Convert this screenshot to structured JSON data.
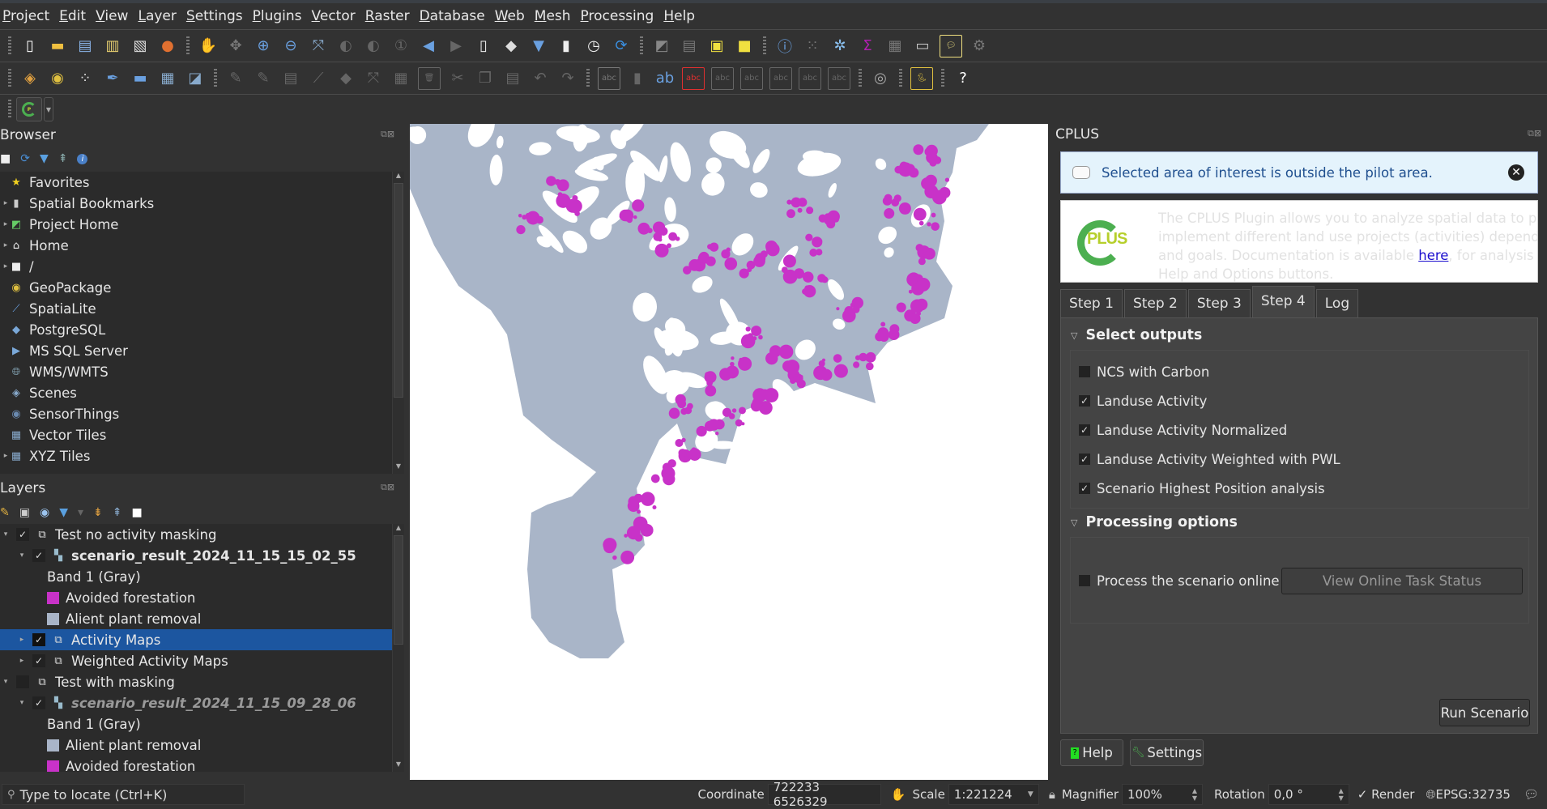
{
  "menubar": [
    "Project",
    "Edit",
    "View",
    "Layer",
    "Settings",
    "Plugins",
    "Vector",
    "Raster",
    "Database",
    "Web",
    "Mesh",
    "Processing",
    "Help"
  ],
  "toolbar1_icons": [
    "new-project-icon",
    "open-project-icon",
    "save-project-icon",
    "new-print-layout-icon",
    "layout-manager-icon",
    "style-manager-icon",
    "pan-icon",
    "pan-to-selection-icon",
    "zoom-in-icon",
    "zoom-out-icon",
    "zoom-full-icon",
    "zoom-to-selection-icon",
    "zoom-to-layer-icon",
    "zoom-native-icon",
    "zoom-last-icon",
    "zoom-next-icon",
    "new-map-view-icon",
    "new-3d-map-icon",
    "new-bookmark-icon",
    "show-bookmarks-icon",
    "temporal-controller-icon",
    "refresh-icon",
    "select-features-icon",
    "open-attribute-table-icon",
    "deselect-icon",
    "select-by-location-icon",
    "identify-icon",
    "statistics-icon",
    "processing-toolbox-icon",
    "field-calculator-icon",
    "attribute-table-icon",
    "measure-icon",
    "map-tips-icon",
    "run-model-icon"
  ],
  "toolbar2_icons": [
    "data-source-manager-icon",
    "new-geopackage-layer-icon",
    "new-temporary-scratch-layer-icon",
    "new-spatialite-layer-icon",
    "new-virtual-layer-icon",
    "new-mesh-layer-icon",
    "new-vector-tile-layer-icon",
    "current-edits-icon",
    "toggle-editing-icon",
    "save-edits-icon",
    "digitize-icon",
    "add-polygon-icon",
    "vertex-tool-icon",
    "modify-attributes-icon",
    "delete-selected-icon",
    "cut-features-icon",
    "copy-features-icon",
    "paste-features-icon",
    "undo-icon",
    "redo-icon",
    "label-toolbar-icon",
    "diagram-icon",
    "highlight-pinned-labels-icon",
    "toggle-labels-icon",
    "pin-labels-icon",
    "show-hide-labels-icon",
    "move-label-icon",
    "rotate-label-icon",
    "change-label-icon",
    "metasearch-icon",
    "python-console-icon",
    "help-contents-icon"
  ],
  "plugin_toolbar": {
    "cplus_button_icon": "cplus-plugin-icon"
  },
  "browser": {
    "title": "Browser",
    "items": [
      {
        "label": "Favorites",
        "icon": "star-icon",
        "expandable": false
      },
      {
        "label": "Spatial Bookmarks",
        "icon": "bookmark-icon",
        "expandable": true
      },
      {
        "label": "Project Home",
        "icon": "project-home-icon",
        "expandable": true
      },
      {
        "label": "Home",
        "icon": "home-folder-icon",
        "expandable": true
      },
      {
        "label": "/",
        "icon": "folder-icon",
        "expandable": true
      },
      {
        "label": "GeoPackage",
        "icon": "geopackage-icon",
        "expandable": false
      },
      {
        "label": "SpatiaLite",
        "icon": "spatialite-icon",
        "expandable": false
      },
      {
        "label": "PostgreSQL",
        "icon": "postgresql-icon",
        "expandable": false
      },
      {
        "label": "MS SQL Server",
        "icon": "mssql-icon",
        "expandable": false
      },
      {
        "label": "WMS/WMTS",
        "icon": "wms-icon",
        "expandable": false
      },
      {
        "label": "Scenes",
        "icon": "scenes-icon",
        "expandable": false
      },
      {
        "label": "SensorThings",
        "icon": "sensorthings-icon",
        "expandable": false
      },
      {
        "label": "Vector Tiles",
        "icon": "vector-tiles-icon",
        "expandable": false
      },
      {
        "label": "XYZ Tiles",
        "icon": "xyz-tiles-icon",
        "expandable": true
      }
    ]
  },
  "layers": {
    "title": "Layers",
    "items": [
      {
        "label": "Test no activity masking",
        "level": 0,
        "checked": true,
        "type": "group",
        "expanded": true,
        "style": "normal"
      },
      {
        "label": "scenario_result_2024_11_15_15_02_55",
        "level": 1,
        "checked": true,
        "type": "raster",
        "expanded": true,
        "style": "bold"
      },
      {
        "label": "Band 1 (Gray)",
        "level": 2,
        "type": "legend-header",
        "style": "normal"
      },
      {
        "label": "Avoided forestation",
        "level": 2,
        "type": "legend",
        "color": "#c832c8",
        "style": "normal"
      },
      {
        "label": "Alient plant removal",
        "level": 2,
        "type": "legend",
        "color": "#a9b5c8",
        "style": "normal"
      },
      {
        "label": "Activity Maps",
        "level": 1,
        "checked": true,
        "type": "group",
        "expanded": false,
        "selected": true,
        "style": "normal"
      },
      {
        "label": "Weighted Activity Maps",
        "level": 1,
        "checked": true,
        "type": "group",
        "expanded": false,
        "style": "normal"
      },
      {
        "label": "Test with masking",
        "level": 0,
        "checked": false,
        "type": "group",
        "expanded": true,
        "style": "normal"
      },
      {
        "label": "scenario_result_2024_11_15_09_28_06",
        "level": 1,
        "checked": true,
        "type": "raster",
        "expanded": true,
        "style": "bold-italic-dim"
      },
      {
        "label": "Band 1 (Gray)",
        "level": 2,
        "type": "legend-header",
        "style": "normal"
      },
      {
        "label": "Alient plant removal",
        "level": 2,
        "type": "legend",
        "color": "#a9b5c8",
        "style": "normal"
      },
      {
        "label": "Avoided forestation",
        "level": 2,
        "type": "legend",
        "color": "#c832c8",
        "style": "normal"
      }
    ]
  },
  "map": {
    "colors": {
      "background": "#ffffff",
      "alien_plant_removal": "#a9b5c8",
      "avoided_forestation": "#c832c8"
    }
  },
  "cplus": {
    "title": "CPLUS",
    "message": "Selected area of interest is outside the pilot area.",
    "logo_text": "PLUS",
    "intro_line1": "The CPLUS Plugin allows you to analyze spatial data to pred",
    "intro_line2": "implement different land use projects (activities) depending",
    "intro_line3_pre": "and goals. Documentation is available ",
    "intro_link": "here",
    "intro_line3_post": ", for analysis co",
    "intro_line4": "Help and Options buttons.",
    "tabs": [
      "Step 1",
      "Step 2",
      "Step 3",
      "Step 4",
      "Log"
    ],
    "active_tab": "Step 4",
    "select_outputs_title": "Select outputs",
    "outputs": [
      {
        "label": "NCS with Carbon",
        "checked": false
      },
      {
        "label": "Landuse Activity",
        "checked": true
      },
      {
        "label": "Landuse Activity Normalized",
        "checked": true
      },
      {
        "label": "Landuse Activity Weighted with PWL",
        "checked": true
      },
      {
        "label": "Scenario Highest Position analysis",
        "checked": true
      }
    ],
    "processing_title": "Processing options",
    "process_online_label": "Process the scenario online",
    "process_online_checked": false,
    "view_status_label": "View Online Task Status",
    "run_label": "Run Scenario",
    "help_label": "Help",
    "settings_label": "Settings"
  },
  "statusbar": {
    "locator_placeholder": "Type to locate (Ctrl+K)",
    "coordinate_label": "Coordinate",
    "coordinate_value": "722233  6526329",
    "scale_label": "Scale",
    "scale_value": "1:221224",
    "magnifier_label": "Magnifier",
    "magnifier_value": "100%",
    "rotation_label": "Rotation",
    "rotation_value": "0,0 °",
    "render_label": "Render",
    "render_checked": true,
    "crs_label": "EPSG:32735"
  }
}
